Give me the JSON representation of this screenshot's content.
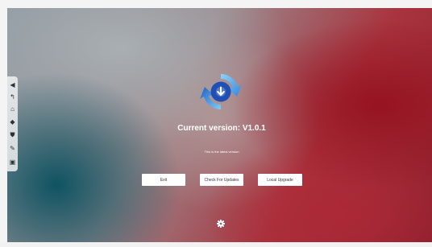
{
  "sidebar": {
    "items": [
      {
        "icon": "collapse-arrow-icon",
        "glyph": "◀"
      },
      {
        "icon": "back-icon",
        "glyph": "↰"
      },
      {
        "icon": "home-icon",
        "glyph": "⌂"
      },
      {
        "icon": "layers-icon",
        "glyph": "◆"
      },
      {
        "icon": "shield-icon",
        "glyph": "⛊"
      },
      {
        "icon": "edit-icon",
        "glyph": "✎"
      },
      {
        "icon": "toolbox-icon",
        "glyph": "▣"
      }
    ]
  },
  "update": {
    "logo_icon": "update-sync-icon",
    "current_version": "Current version: V1.0.1",
    "status": "This is the latest version"
  },
  "buttons": {
    "exit": "Exit",
    "check": "Check For Updates",
    "local": "Local Upgrade"
  },
  "footer": {
    "settings_icon": "gear-icon"
  },
  "colors": {
    "logo_blue": "#1e6fd9",
    "logo_light": "#6fc1f2",
    "frame": "#f4f4f4"
  }
}
